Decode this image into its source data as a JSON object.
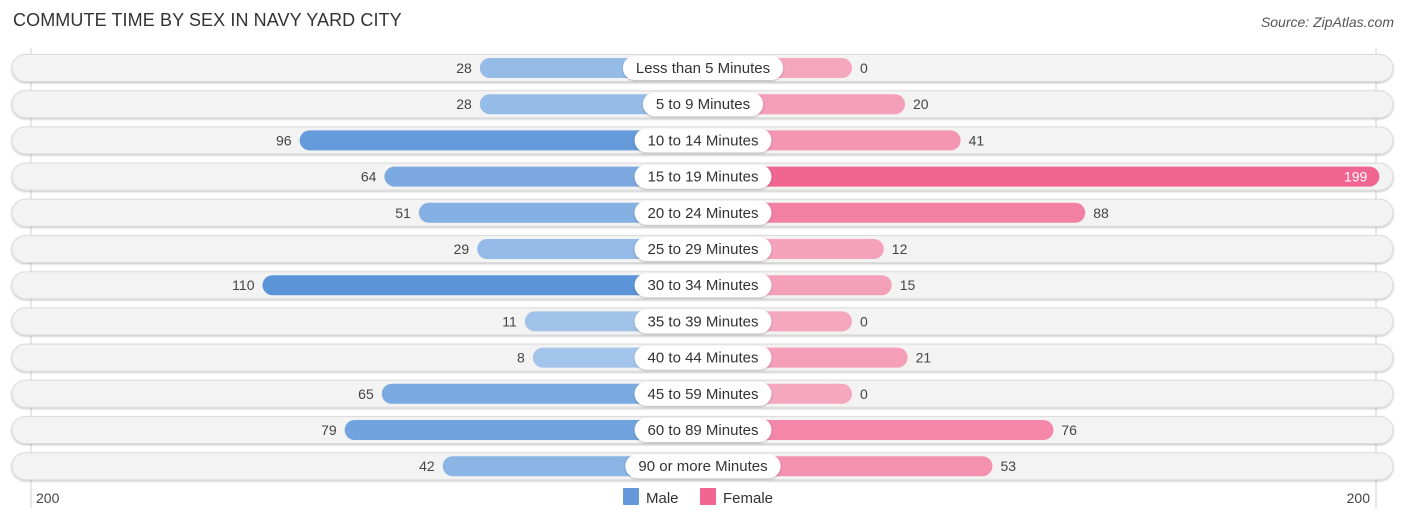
{
  "title": "COMMUTE TIME BY SEX IN NAVY YARD CITY",
  "source": "Source: ZipAtlas.com",
  "chart_data": {
    "type": "bar",
    "orientation": "horizontal-diverging",
    "title": "COMMUTE TIME BY SEX IN NAVY YARD CITY",
    "categories": [
      "Less than 5 Minutes",
      "5 to 9 Minutes",
      "10 to 14 Minutes",
      "15 to 19 Minutes",
      "20 to 24 Minutes",
      "25 to 29 Minutes",
      "30 to 34 Minutes",
      "35 to 39 Minutes",
      "40 to 44 Minutes",
      "45 to 59 Minutes",
      "60 to 89 Minutes",
      "90 or more Minutes"
    ],
    "series": [
      {
        "name": "Male",
        "color": "#6399d9",
        "values": [
          28,
          28,
          96,
          64,
          51,
          29,
          110,
          11,
          8,
          65,
          79,
          42
        ]
      },
      {
        "name": "Female",
        "color": "#f06592",
        "values": [
          0,
          20,
          41,
          199,
          88,
          12,
          15,
          0,
          21,
          0,
          76,
          53
        ]
      }
    ],
    "axis": {
      "left_label": "200",
      "right_label": "200",
      "range": [
        0,
        200
      ]
    },
    "legend": {
      "position": "bottom-center",
      "items": [
        "Male",
        "Female"
      ]
    },
    "grid": false
  }
}
